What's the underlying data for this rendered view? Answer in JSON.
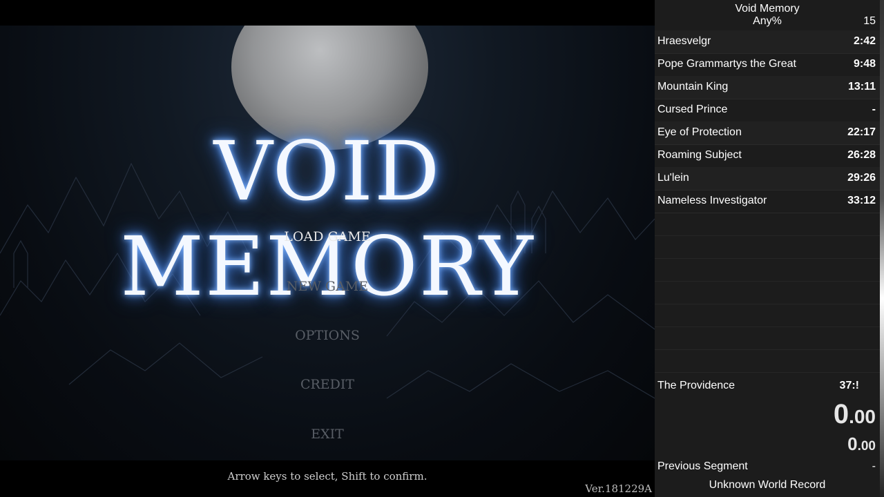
{
  "game": {
    "title": "VOID MEMORY",
    "menu": [
      {
        "label": "LOAD GAME",
        "state": "active"
      },
      {
        "label": "NEW GAME",
        "state": "dim"
      },
      {
        "label": "OPTIONS",
        "state": "dim"
      },
      {
        "label": "CREDIT",
        "state": "dim"
      },
      {
        "label": "EXIT",
        "state": "dim"
      }
    ],
    "hint": "Arrow keys to select, Shift to confirm.",
    "version": "Ver.181229A"
  },
  "splits": {
    "game_name": "Void Memory",
    "category": "Any%",
    "attempts": "15",
    "rows": [
      {
        "name": "Hraesvelgr",
        "time": "2:42"
      },
      {
        "name": "Pope Grammartys the Great",
        "time": "9:48"
      },
      {
        "name": "Mountain King",
        "time": "13:11"
      },
      {
        "name": "Cursed Prince",
        "time": "-"
      },
      {
        "name": "Eye of Protection",
        "time": "22:17"
      },
      {
        "name": "Roaming Subject",
        "time": "26:28"
      },
      {
        "name": "Lu'lein",
        "time": "29:26"
      },
      {
        "name": "Nameless Investigator",
        "time": "33:12"
      }
    ],
    "final": {
      "name": "The Providence",
      "time": "37:!"
    },
    "timer": {
      "main_int": "0",
      "main_dec": ".00",
      "sub_int": "0",
      "sub_dec": ".00"
    },
    "previous_segment": {
      "label": "Previous Segment",
      "value": "-"
    },
    "world_record": "Unknown World Record"
  },
  "colors": {
    "title_glow": "#4a86e8",
    "panel_bg": "#1c1c1c",
    "menu_active": "#e8e8e8",
    "menu_dim": "#595e66"
  }
}
